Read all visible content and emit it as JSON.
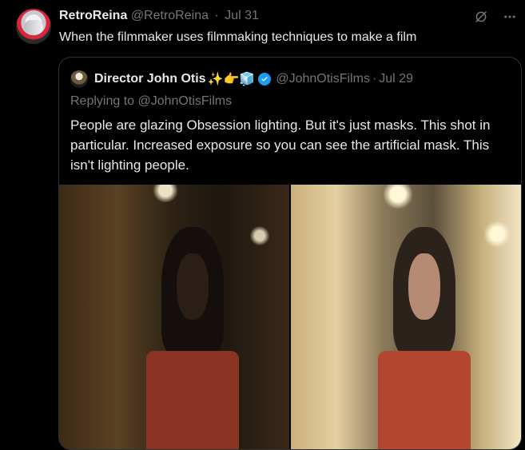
{
  "tweet": {
    "display_name": "RetroReina",
    "handle": "@RetroReina",
    "separator": "·",
    "date": "Jul 31",
    "text": "When the filmmaker uses filmmaking techniques to make a film"
  },
  "quote": {
    "display_name": "Director John Otis",
    "emojis": "✨👉🧊",
    "handle": "@JohnOtisFilms",
    "separator": "·",
    "date": "Jul 29",
    "replying": "Replying to @JohnOtisFilms",
    "text": "People are glazing Obsession lighting. But it's just masks. This shot in particular. Increased exposure so you can see the artificial mask. This isn't lighting people."
  },
  "icons": {
    "grok": "grok-icon",
    "more": "more-icon",
    "verified": "verified-badge-icon"
  },
  "colors": {
    "background": "#000000",
    "text": "#e7e9ea",
    "muted": "#71767b",
    "border": "#2f3336",
    "verified": "#1d9bf0"
  }
}
